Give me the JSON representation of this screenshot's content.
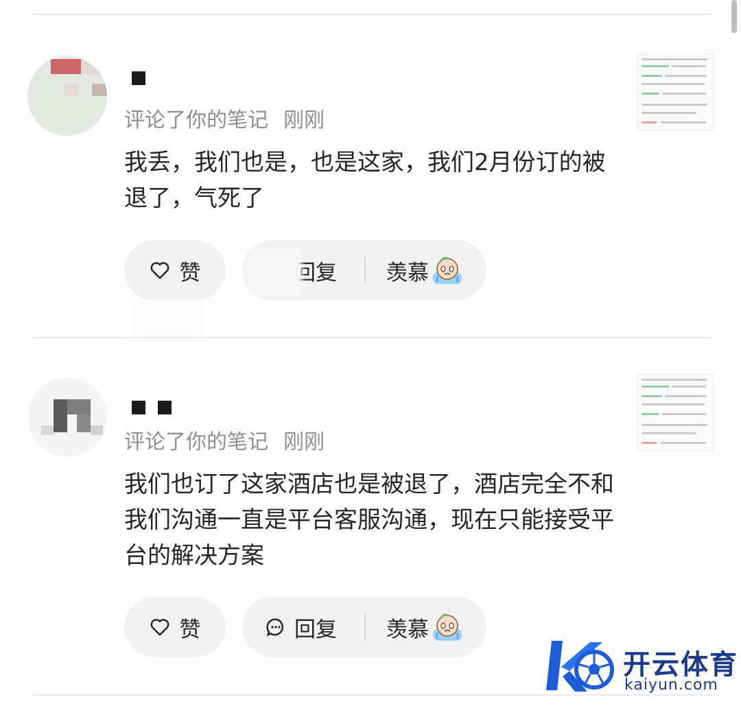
{
  "comments": [
    {
      "meta": "评论了你的笔记",
      "time": "刚刚",
      "text": "我丢，我们也是，也是这家，我们2月份订的被退了，气死了",
      "like_label": "赞",
      "reply_label": "回复",
      "envy_label": "羡慕"
    },
    {
      "meta": "评论了你的笔记",
      "time": "刚刚",
      "text": "我们也订了这家酒店也是被退了，酒店完全不和我们沟通一直是平台客服沟通，现在只能接受平台的解决方案",
      "like_label": "赞",
      "reply_label": "回复",
      "envy_label": "羡慕"
    }
  ],
  "watermark": {
    "name": "开云体育",
    "url": "kaiyun.com",
    "color": "#1e3a8a"
  },
  "icons": {
    "like": "heart-outline-icon",
    "reply": "chat-bubble-icon",
    "envy": "crying-emoji-icon"
  }
}
